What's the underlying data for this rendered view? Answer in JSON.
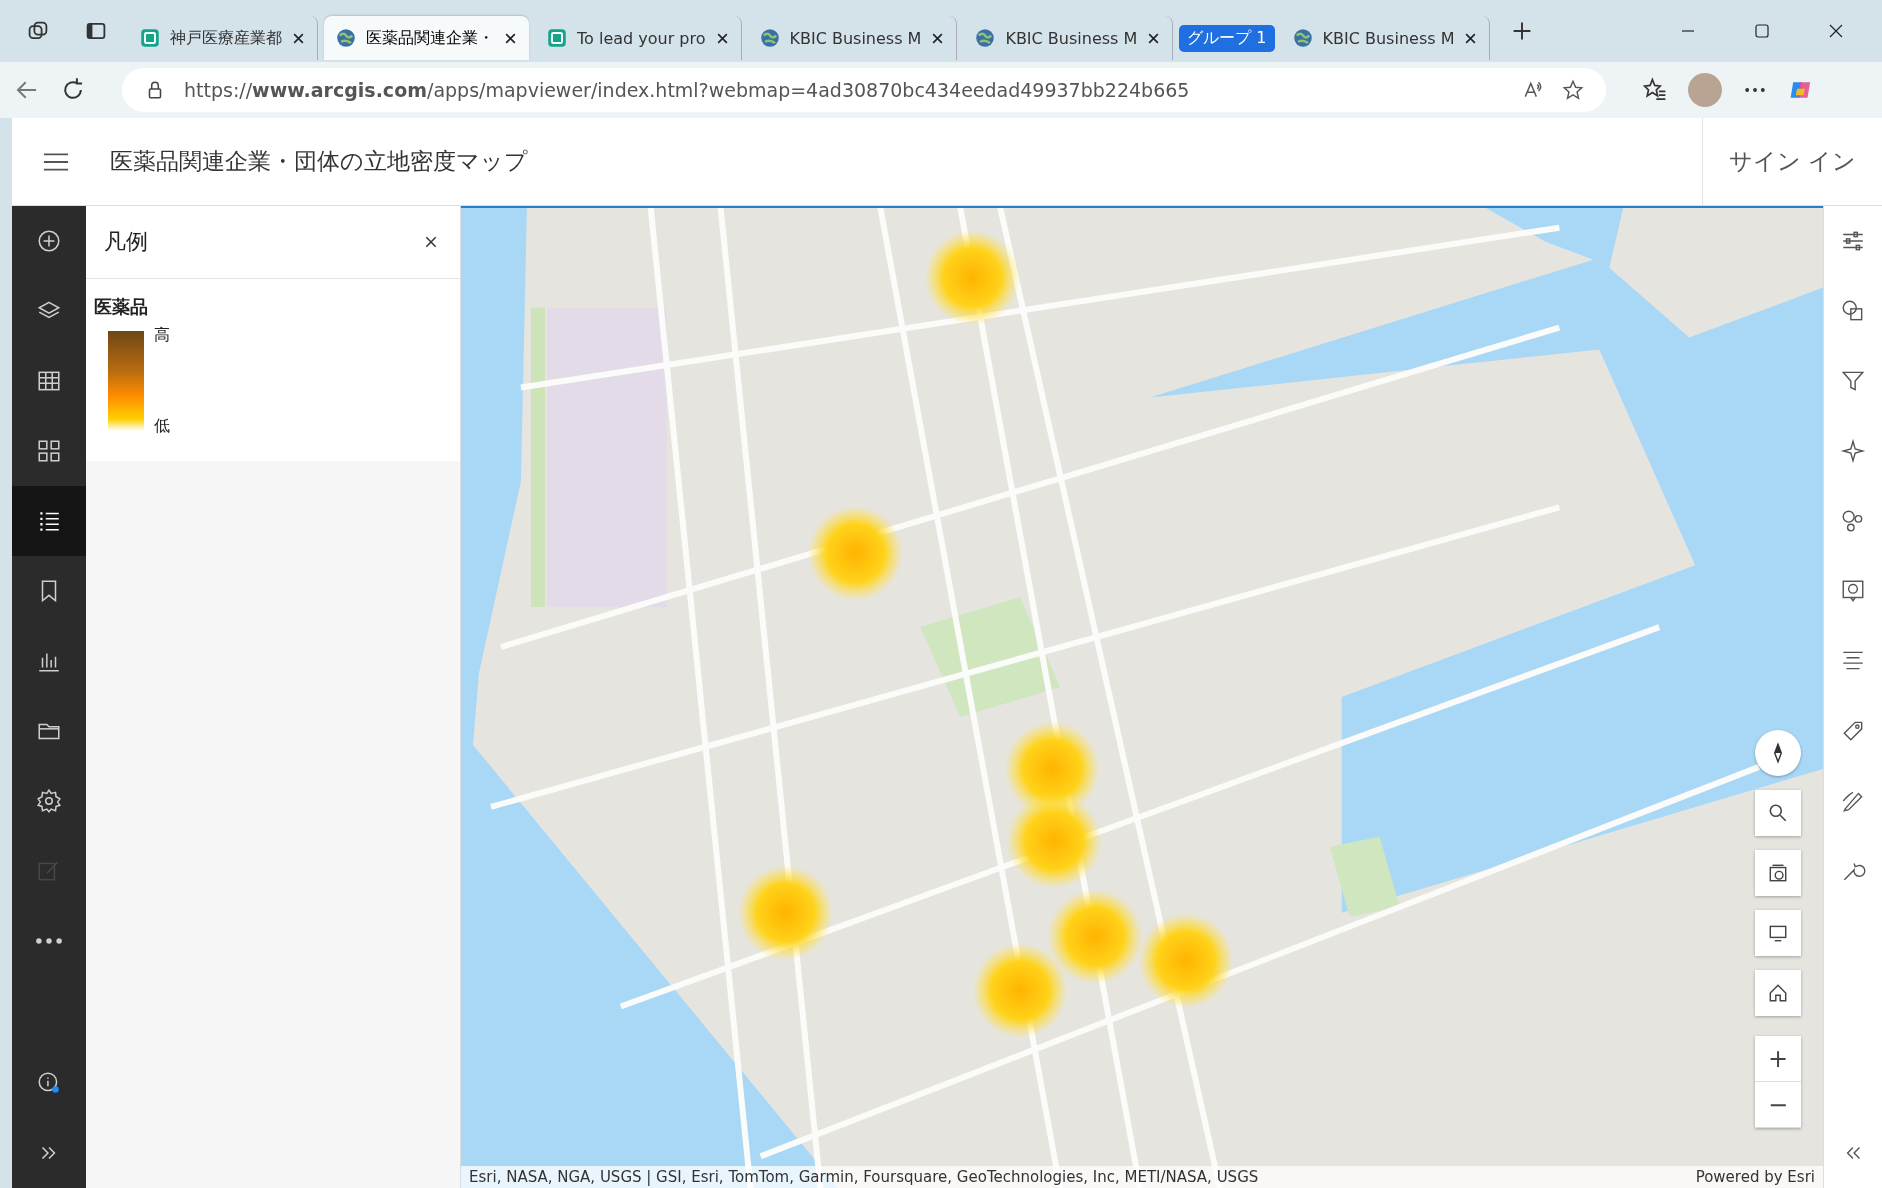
{
  "browser": {
    "tabs": [
      {
        "kind": "app-tab",
        "title": "神戸医療産業都",
        "selected": false
      },
      {
        "kind": "web-tab",
        "title": "医薬品関連企業・",
        "selected": true
      },
      {
        "kind": "app-tab",
        "title": "To lead your pro",
        "selected": false
      },
      {
        "kind": "web-tab",
        "title": "KBIC Business M",
        "selected": false
      },
      {
        "kind": "web-tab",
        "title": "KBIC Business M",
        "selected": false
      },
      {
        "kind": "group",
        "title": "グループ 1"
      },
      {
        "kind": "web-tab",
        "title": "KBIC Business M",
        "selected": false
      }
    ],
    "url": "https://**www.arcgis.com**/apps/mapviewer/index.html?webmap=4ad30870bc434eedad49937bb224b665"
  },
  "app": {
    "title": "医薬品関連企業・団体の立地密度マップ",
    "sign_in": "サイン イン"
  },
  "left_toolbar": [
    {
      "kind": "add",
      "selected": false,
      "disabled": false
    },
    {
      "kind": "layers",
      "selected": false,
      "disabled": false
    },
    {
      "kind": "table",
      "selected": false,
      "disabled": false
    },
    {
      "kind": "grid",
      "selected": false,
      "disabled": false
    },
    {
      "kind": "legend",
      "selected": true,
      "disabled": false
    },
    {
      "kind": "bookmark",
      "selected": false,
      "disabled": false
    },
    {
      "kind": "chart",
      "selected": false,
      "disabled": false
    },
    {
      "kind": "folder",
      "selected": false,
      "disabled": false
    },
    {
      "kind": "settings",
      "selected": false,
      "disabled": false
    },
    {
      "kind": "sketch",
      "selected": false,
      "disabled": true
    },
    {
      "kind": "more",
      "selected": false,
      "disabled": false
    },
    {
      "kind": "info",
      "selected": false,
      "disabled": false
    },
    {
      "kind": "expand",
      "selected": false,
      "disabled": false
    }
  ],
  "legend": {
    "title": "凡例",
    "layer": "医薬品",
    "high": "高",
    "low": "低"
  },
  "map": {
    "zoom_in": "+",
    "zoom_out": "−",
    "attribution": "Esri, NASA, NGA, USGS | GSI, Esri, TomTom, Garmin, Foursquare, GeoTechnologies, Inc, METI/NASA, USGS",
    "powered_by": "Powered by Esri"
  },
  "right_toolbar": [
    {
      "kind": "properties"
    },
    {
      "kind": "styles"
    },
    {
      "kind": "filter"
    },
    {
      "kind": "effects"
    },
    {
      "kind": "clustering"
    },
    {
      "kind": "popups"
    },
    {
      "kind": "fields"
    },
    {
      "kind": "labels"
    },
    {
      "kind": "sketch"
    },
    {
      "kind": "tools"
    },
    {
      "kind": "collapse"
    }
  ]
}
